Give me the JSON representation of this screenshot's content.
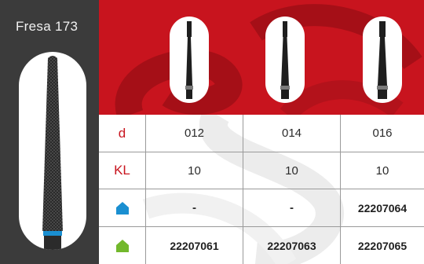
{
  "sidebar": {
    "title": "Fresa 173"
  },
  "table": {
    "rows": [
      {
        "label": "d",
        "values": [
          "012",
          "014",
          "016"
        ]
      },
      {
        "label": "KL",
        "values": [
          "10",
          "10",
          "10"
        ]
      },
      {
        "icon": "blue-house-icon",
        "icon_color": "#1a8fd1",
        "values": [
          "-",
          "-",
          "22207064"
        ]
      },
      {
        "icon": "green-house-icon",
        "icon_color": "#72b82c",
        "values": [
          "22207061",
          "22207063",
          "22207065"
        ]
      }
    ]
  },
  "colors": {
    "accent_red": "#c8141e",
    "sidebar_gray": "#3b3b3b"
  }
}
